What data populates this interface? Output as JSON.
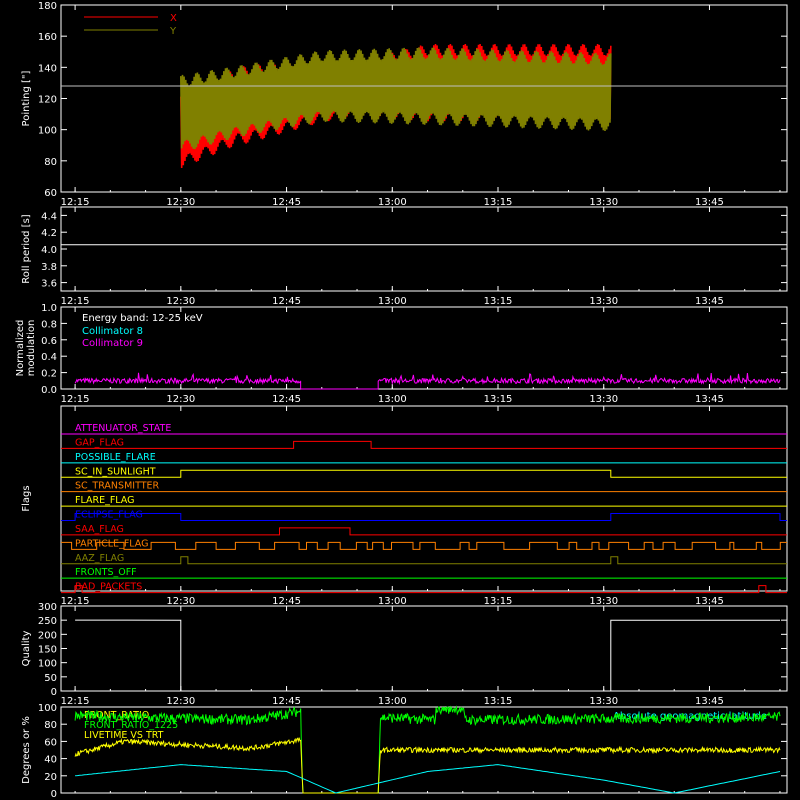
{
  "chart_data": [
    {
      "id": "pointing",
      "type": "line",
      "ylabel": "Pointing [\"]",
      "ylim": [
        60,
        180
      ],
      "yticks": [
        60,
        80,
        100,
        120,
        140,
        160,
        180
      ],
      "xticks": [
        "12:15",
        "12:30",
        "12:45",
        "13:00",
        "13:15",
        "13:30",
        "13:45"
      ],
      "legend": [
        {
          "name": "X",
          "color": "#ff0000"
        },
        {
          "name": "Y",
          "color": "#808000"
        }
      ],
      "series": [
        {
          "name": "X",
          "color": "#ff0000",
          "start": "12:30",
          "end": "13:31",
          "center": [
            [
              0,
              100
            ],
            [
              8,
              115
            ],
            [
              20,
              125
            ],
            [
              35,
              130
            ],
            [
              61,
              130
            ]
          ],
          "amplitude": [
            [
              0,
              25
            ],
            [
              10,
              25
            ],
            [
              25,
              18
            ],
            [
              35,
              25
            ],
            [
              61,
              25
            ]
          ]
        },
        {
          "name": "Y",
          "color": "#808000",
          "start": "12:30",
          "end": "13:31",
          "center": [
            [
              0,
              110
            ],
            [
              8,
              118
            ],
            [
              20,
              128
            ],
            [
              35,
              128
            ],
            [
              61,
              124
            ]
          ],
          "amplitude": [
            [
              0,
              25
            ],
            [
              8,
              23
            ],
            [
              20,
              23
            ],
            [
              35,
              25
            ],
            [
              61,
              25
            ]
          ]
        }
      ],
      "reference_line": {
        "value": 128,
        "color": "#c0c0c0"
      }
    },
    {
      "id": "roll",
      "type": "line",
      "ylabel": "Roll period [s]",
      "ylim": [
        3.5,
        4.5
      ],
      "yticks": [
        3.6,
        3.8,
        4.0,
        4.2,
        4.4
      ],
      "xticks": [
        "12:15",
        "12:30",
        "12:45",
        "13:00",
        "13:15",
        "13:30",
        "13:45"
      ],
      "series": [
        {
          "name": "",
          "color": "#ffffff",
          "value": 4.05
        }
      ]
    },
    {
      "id": "modulation",
      "type": "line",
      "ylabel": "Normalized modulation",
      "ylim": [
        0,
        1
      ],
      "yticks": [
        0.0,
        0.2,
        0.4,
        0.6,
        0.8,
        1.0
      ],
      "xticks": [
        "12:15",
        "12:30",
        "12:45",
        "13:00",
        "13:15",
        "13:30",
        "13:45"
      ],
      "annotation": "Energy band: 12-25 keV",
      "legend": [
        {
          "name": "Collimator 8",
          "color": "#00ffff"
        },
        {
          "name": "Collimator 9",
          "color": "#ff00ff"
        }
      ],
      "series": [
        {
          "name": "Collimator 9",
          "color": "#ff00ff",
          "base": 0.1,
          "noise": 0.06,
          "segments": [
            [
              "12:15",
              "12:47"
            ],
            [
              "12:58",
              "13:55"
            ]
          ],
          "gap_value": 0.0
        }
      ]
    },
    {
      "id": "flags",
      "type": "line",
      "ylabel": "Flags",
      "xticks": [
        "12:15",
        "12:30",
        "12:45",
        "13:00",
        "13:15",
        "13:30",
        "13:45"
      ],
      "flags": [
        {
          "name": "ATTENUATOR_STATE",
          "color": "#ff00ff",
          "highs": []
        },
        {
          "name": "GAP_FLAG",
          "color": "#ff0000",
          "highs": [
            [
              "12:46",
              "12:57"
            ]
          ]
        },
        {
          "name": "POSSIBLE_FLARE",
          "color": "#00ffff",
          "highs": []
        },
        {
          "name": "SC_IN_SUNLIGHT",
          "color": "#ffff00",
          "highs": [
            [
              "12:30",
              "13:31"
            ]
          ]
        },
        {
          "name": "SC_TRANSMITTER",
          "color": "#ff8000",
          "highs": []
        },
        {
          "name": "FLARE_FLAG",
          "color": "#ffff00",
          "highs": []
        },
        {
          "name": "ECLIPSE_FLAG",
          "color": "#0000ff",
          "highs": [
            [
              "12:15",
              "12:30"
            ],
            [
              "13:31",
              "13:55"
            ]
          ]
        },
        {
          "name": "SAA_FLAG",
          "color": "#ff0000",
          "highs": [
            [
              "12:44",
              "12:54"
            ]
          ]
        },
        {
          "name": "PARTICLE_FLAG",
          "color": "#ff8000",
          "spiky": true,
          "highs": []
        },
        {
          "name": "AAZ_FLAG",
          "color": "#808000",
          "highs": [
            [
              "12:30",
              "12:31"
            ],
            [
              "13:31",
              "13:32"
            ]
          ]
        },
        {
          "name": "FRONTS_OFF",
          "color": "#00ff00",
          "highs": []
        },
        {
          "name": "BAD_PACKETS",
          "color": "#ff0000",
          "highs": [
            [
              "12:15",
              "12:16"
            ],
            [
              "13:52",
              "13:53"
            ]
          ]
        }
      ]
    },
    {
      "id": "quality",
      "type": "line",
      "ylabel": "Quality",
      "ylim": [
        0,
        300
      ],
      "yticks": [
        0,
        50,
        100,
        150,
        200,
        250,
        300
      ],
      "xticks": [
        "12:15",
        "12:30",
        "12:45",
        "13:00",
        "13:15",
        "13:30",
        "13:45"
      ],
      "series": [
        {
          "name": "",
          "color": "#ffffff",
          "steps": [
            [
              "12:15",
              250
            ],
            [
              "12:30",
              0
            ],
            [
              "13:31",
              250
            ],
            [
              "13:55",
              250
            ]
          ]
        }
      ]
    },
    {
      "id": "ratios",
      "type": "line",
      "ylabel": "Degrees or %",
      "ylim": [
        0,
        100
      ],
      "yticks": [
        0,
        20,
        40,
        60,
        80,
        100
      ],
      "legend": [
        {
          "name": "FRONT_RATIO",
          "color": "#ffff00"
        },
        {
          "name": "FRONT_RATIO_1225",
          "color": "#00ff00"
        },
        {
          "name": "LIVETIME VS TRT",
          "color": "#ffff00"
        }
      ],
      "annotation": "Absolute geomagnetic latitude",
      "annotation_color": "#00ffff",
      "series": [
        {
          "name": "FRONT_RATIO_1225",
          "color": "#00ff00",
          "noise": 6,
          "levels": [
            [
              "12:15",
              90
            ],
            [
              "12:22",
              88
            ],
            [
              "12:40",
              85
            ],
            [
              "12:47",
              95
            ],
            [
              "12:47.3",
              0
            ],
            [
              "12:58",
              0
            ],
            [
              "12:58.3",
              88
            ],
            [
              "13:06",
              85
            ],
            [
              "13:06.3",
              98
            ],
            [
              "13:10",
              98
            ],
            [
              "13:10.3",
              85
            ],
            [
              "13:55",
              88
            ]
          ]
        },
        {
          "name": "FRONT_RATIO",
          "color": "#ffff00",
          "noise": 3,
          "levels": [
            [
              "12:15",
              45
            ],
            [
              "12:22",
              60
            ],
            [
              "12:40",
              52
            ],
            [
              "12:47",
              62
            ],
            [
              "12:47.3",
              0
            ],
            [
              "12:58",
              0
            ],
            [
              "12:58.3",
              50
            ],
            [
              "13:55",
              50
            ]
          ]
        },
        {
          "name": "Absolute geomagnetic latitude",
          "color": "#00ffff",
          "points": [
            [
              "12:15",
              20
            ],
            [
              "12:30",
              33
            ],
            [
              "12:45",
              25
            ],
            [
              "12:52",
              0
            ],
            [
              "13:05",
              25
            ],
            [
              "13:15",
              33
            ],
            [
              "13:30",
              15
            ],
            [
              "13:40",
              0
            ],
            [
              "13:55",
              25
            ]
          ]
        }
      ]
    }
  ]
}
